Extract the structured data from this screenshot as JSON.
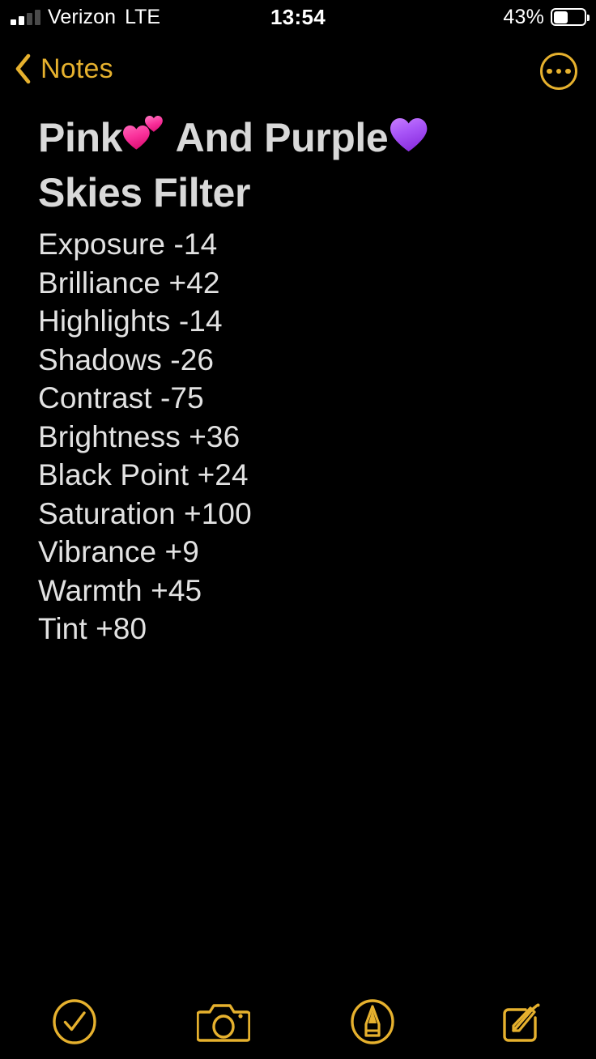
{
  "status_bar": {
    "carrier": "Verizon",
    "network": "LTE",
    "time": "13:54",
    "battery_percent": "43%",
    "battery_level": 43,
    "signal_bars_total": 4,
    "signal_bars_active": 2,
    "icons": [
      "signal-bars-icon",
      "battery-icon"
    ]
  },
  "nav_bar": {
    "back_label": "Notes",
    "back_icon": "chevron-left-icon",
    "more_icon": "ellipsis-circle-icon",
    "accent_color": "#E6B12E"
  },
  "note": {
    "title_part1": "Pink",
    "title_emoji1": "two-hearts",
    "title_part2": " And Purple",
    "title_emoji2": "purple-heart",
    "title_part3": "Skies Filter",
    "title_text": "Pink💕 And Purple💜 Skies Filter",
    "text_color": "#E2E2E2",
    "lines": [
      "Exposure -14",
      "Brilliance +42",
      "Highlights -14",
      "Shadows -26",
      "Contrast -75",
      "Brightness +36",
      "Black Point +24",
      "Saturation +100",
      "Vibrance +9",
      "Warmth +45",
      "Tint +80"
    ],
    "settings": [
      {
        "name": "Exposure",
        "value": "-14"
      },
      {
        "name": "Brilliance",
        "value": "+42"
      },
      {
        "name": "Highlights",
        "value": "-14"
      },
      {
        "name": "Shadows",
        "value": "-26"
      },
      {
        "name": "Contrast",
        "value": "-75"
      },
      {
        "name": "Brightness",
        "value": "+36"
      },
      {
        "name": "Black Point",
        "value": "+24"
      },
      {
        "name": "Saturation",
        "value": "+100"
      },
      {
        "name": "Vibrance",
        "value": "+9"
      },
      {
        "name": "Warmth",
        "value": "+45"
      },
      {
        "name": "Tint",
        "value": "+80"
      }
    ]
  },
  "toolbar": {
    "items": [
      {
        "icon": "checkmark-circle-icon",
        "label": "Checklist"
      },
      {
        "icon": "camera-icon",
        "label": "Camera"
      },
      {
        "icon": "markup-pen-icon",
        "label": "Markup"
      },
      {
        "icon": "compose-icon",
        "label": "New Note"
      }
    ],
    "accent_color": "#E6B12E"
  },
  "theme": {
    "background": "#000000",
    "accent": "#E6B12E",
    "body_text": "#E2E2E2",
    "title_text": "#D9D9D9",
    "pink_heart": "#F63A8F",
    "purple_heart": "#A855F7"
  }
}
